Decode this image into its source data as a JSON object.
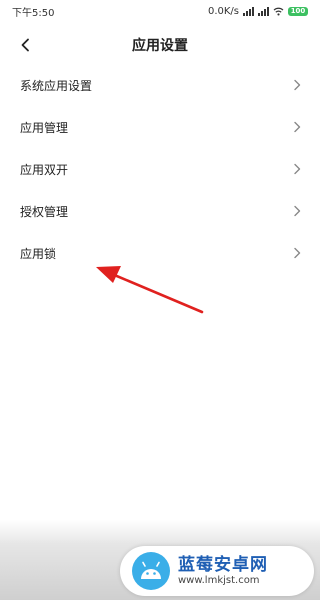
{
  "status_bar": {
    "time": "下午5:50",
    "net_speed": "0.0K/s",
    "battery": "100",
    "battery_color": "#3cc061"
  },
  "header": {
    "title": "应用设置",
    "back_icon": "chevron-left-icon"
  },
  "menu": {
    "items": [
      {
        "label": "系统应用设置"
      },
      {
        "label": "应用管理"
      },
      {
        "label": "应用双开"
      },
      {
        "label": "授权管理"
      },
      {
        "label": "应用锁"
      }
    ],
    "item_icon": "chevron-right-icon"
  },
  "annotation": {
    "arrow_color": "#e0211f",
    "points_to": "应用锁"
  },
  "watermark": {
    "title": "蓝莓安卓网",
    "url": "www.lmkjst.com",
    "logo_color": "#3aaee8"
  }
}
